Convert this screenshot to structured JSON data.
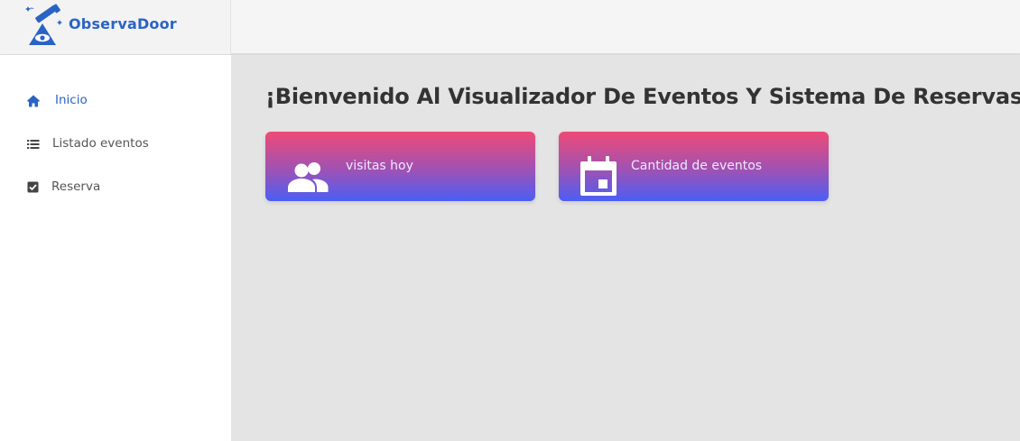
{
  "brand": {
    "name": "ObservaDoor",
    "logo_icon": "telescope-eye-logo"
  },
  "sidebar": {
    "items": [
      {
        "label": "Inicio",
        "icon": "home-icon",
        "active": true
      },
      {
        "label": "Listado eventos",
        "icon": "list-icon",
        "active": false
      },
      {
        "label": "Reserva",
        "icon": "checkbox-icon",
        "active": false
      }
    ]
  },
  "main": {
    "title": "¡Bienvenido Al Visualizador De Eventos Y Sistema De Reservas!",
    "cards": [
      {
        "label": "visitas hoy",
        "icon": "people-icon"
      },
      {
        "label": "Cantidad de eventos",
        "icon": "calendar-icon"
      }
    ]
  },
  "colors": {
    "accent": "#2a63c6",
    "card_gradient_top": "#ef4a76",
    "card_gradient_bottom": "#4b5ef5",
    "background": "#e4e4e4"
  }
}
